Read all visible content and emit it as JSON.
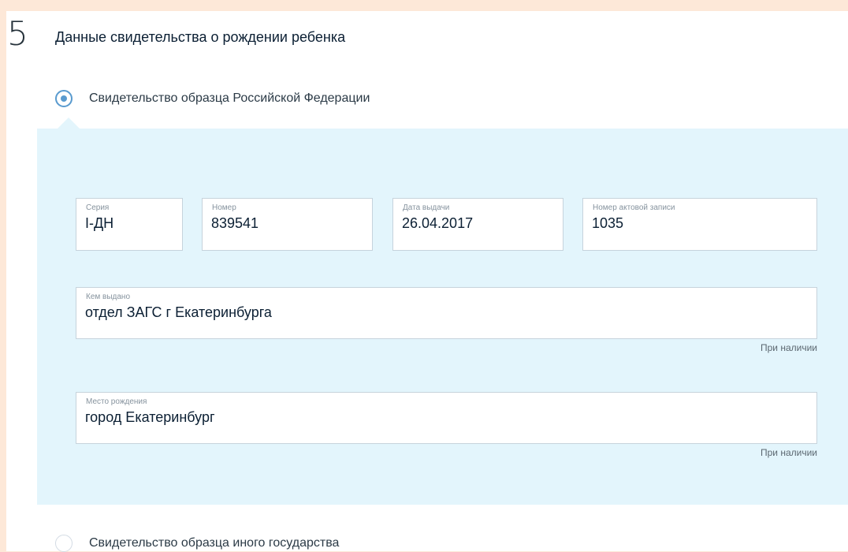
{
  "section": {
    "number": "5",
    "title": "Данные свидетельства о рождении ребенка"
  },
  "options": {
    "russian": {
      "label": "Свидетельство образца Российской Федерации",
      "selected": true
    },
    "foreign": {
      "label": "Свидетельство образца иного государства",
      "selected": false
    }
  },
  "fields": {
    "series": {
      "label": "Серия",
      "value": "I-ДН"
    },
    "number": {
      "label": "Номер",
      "value": "839541"
    },
    "issue_date": {
      "label": "Дата выдачи",
      "value": "26.04.2017"
    },
    "record_number": {
      "label": "Номер актовой записи",
      "value": "1035"
    },
    "issued_by": {
      "label": "Кем выдано",
      "value": "отдел ЗАГС г Екатеринбурга",
      "hint": "При наличии"
    },
    "birth_place": {
      "label": "Место рождения",
      "value": "город Екатеринбург",
      "hint": "При наличии"
    }
  },
  "colors": {
    "page_background": "#fde8d8",
    "panel_background": "#e3f5fc",
    "radio_accent": "#5a9bcf",
    "field_border": "#c6d3dc"
  }
}
